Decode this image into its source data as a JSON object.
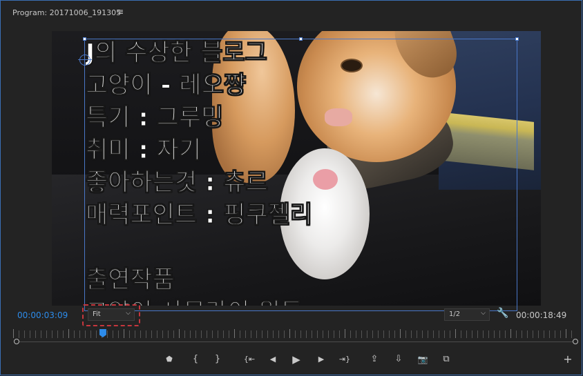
{
  "panel": {
    "title": "Program: 20171006_191305",
    "menu_glyph": "≡"
  },
  "overlay_lines": [
    "J의 수상한 블로그",
    "고양이 - 레오쨩",
    "특기 : 그루밍",
    "취미 : 자기",
    "좋아하는것 : 츄르",
    "매력포인트 : 핑쿠젤리",
    "",
    "출연작품",
    "고양이 사무라이 원투"
  ],
  "timecode": {
    "current": "00:00:03:09",
    "duration": "00:00:18:49"
  },
  "zoom": {
    "value": "Fit"
  },
  "resolution": {
    "value": "1/2"
  },
  "playhead_fraction": 0.16,
  "icons": {
    "chevron": "⌵",
    "wrench": "🔧",
    "marker": "⬟",
    "mark_in": "{",
    "mark_out": "}",
    "go_in": "{⇤",
    "step_back": "◀",
    "play": "▶",
    "step_forward": "▶",
    "go_out": "⇥}",
    "lift": "⇪",
    "extract": "⇩",
    "camera": "📷",
    "compare": "⧉",
    "plus": "+"
  },
  "colors": {
    "accent": "#2d8ceb",
    "highlight_dash": "#c6363d",
    "selection": "#4a78c9"
  }
}
